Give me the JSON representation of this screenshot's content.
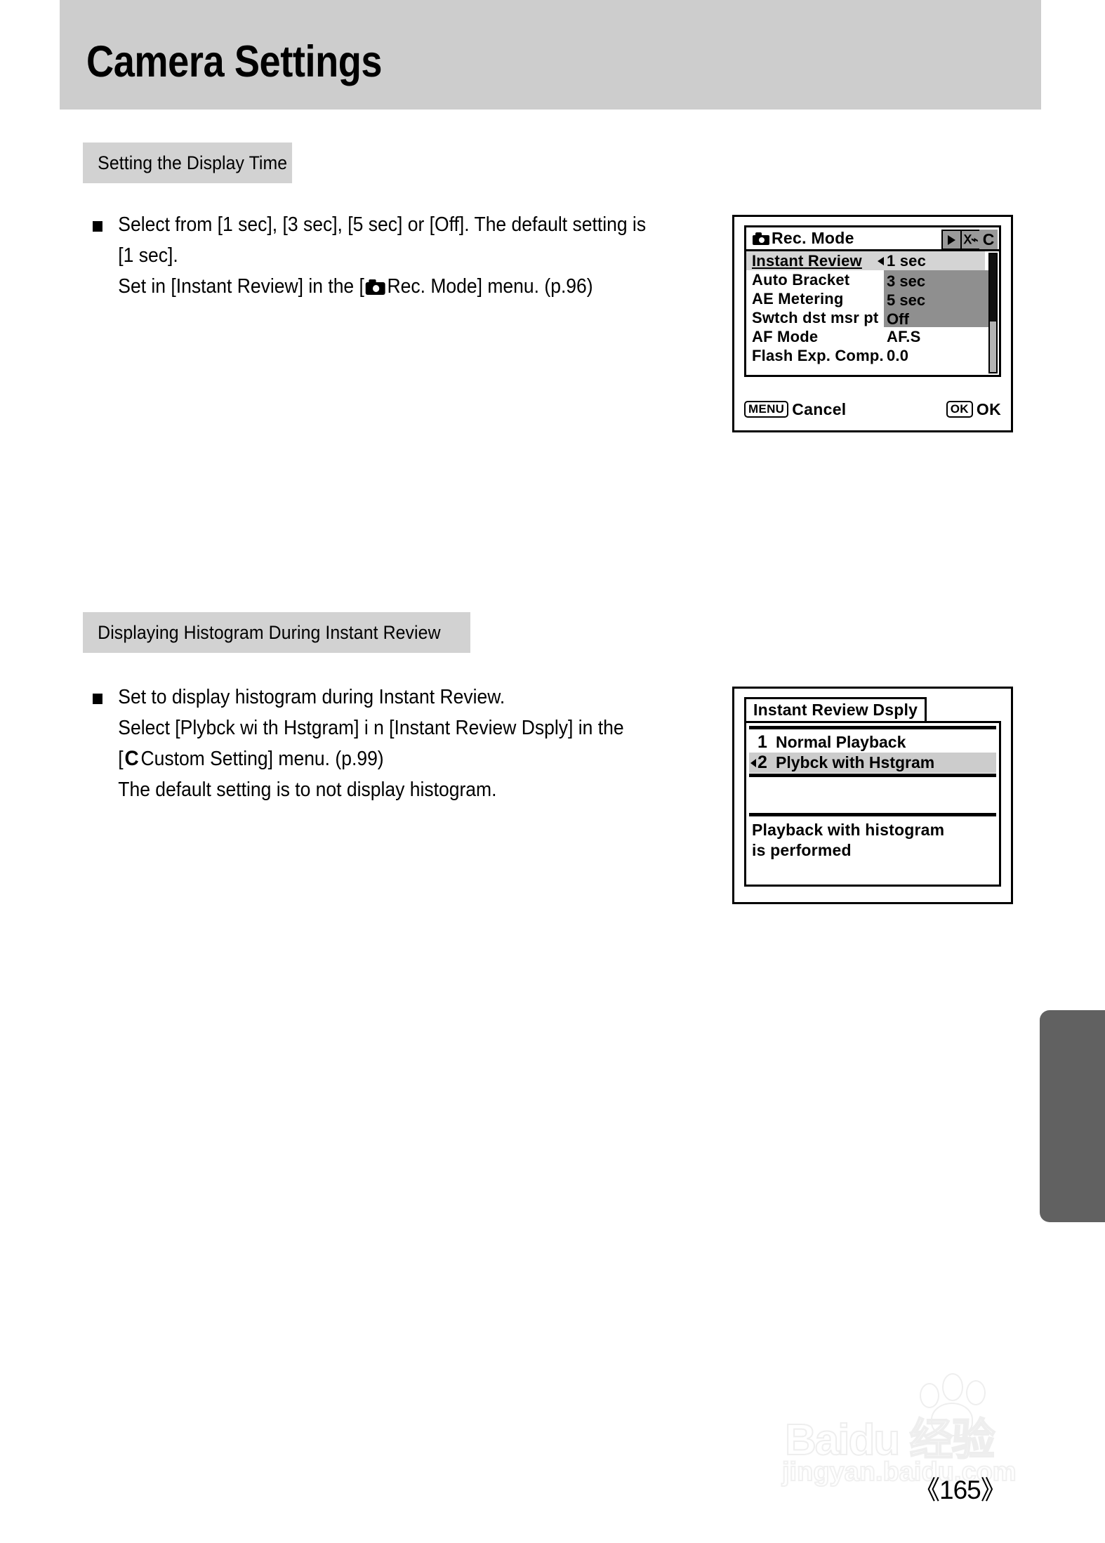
{
  "page": {
    "title": "Camera Settings",
    "number": "《165》"
  },
  "sections": [
    {
      "heading": "Setting the Display Time",
      "lines": [
        {
          "pre": "Select from [1 sec], [3 sec], [5 sec] or [Off]. The default setting is",
          "icon": null,
          "post": ""
        },
        {
          "pre": "[1 sec].",
          "icon": null,
          "post": ""
        },
        {
          "pre": "Set in [Instant Review] in the [",
          "icon": "camera-icon",
          "post": "Rec. Mode] menu. (p.96)"
        }
      ]
    },
    {
      "heading": "Displaying Histogram During Instant Review",
      "lines": [
        {
          "pre": "Set to display histogram during Instant Review.",
          "icon": null,
          "post": ""
        },
        {
          "pre": "Select [Plybck wi th Hstgram] i n [Instant Review Dsply] in the",
          "icon": null,
          "post": ""
        },
        {
          "pre": "[",
          "icon": "c-icon",
          "post": "Custom Setting] menu. (p.99)"
        },
        {
          "pre": "The default setting is to not display histogram.",
          "icon": null,
          "post": ""
        }
      ]
    }
  ],
  "lcd_rec_mode": {
    "title": "Rec. Mode",
    "tabs": [
      "playback-icon",
      "wrench-icon",
      "C"
    ],
    "rows": [
      {
        "label": "Instant Review",
        "value": "1 sec",
        "selected": true
      },
      {
        "label": "Auto Bracket",
        "value": "",
        "selected": false
      },
      {
        "label": "AE Metering",
        "value": "",
        "selected": false
      },
      {
        "label": "Swtch dst msr pt",
        "value": "",
        "selected": false
      },
      {
        "label": "AF Mode",
        "value": "AF.S",
        "selected": false
      },
      {
        "label": "Flash Exp. Comp.",
        "value": "0.0",
        "selected": false
      }
    ],
    "dropdown_options": [
      "3 sec",
      "5 sec",
      "Off"
    ],
    "footer": {
      "left_key": "MENU",
      "left_label": "Cancel",
      "right_key": "OK",
      "right_label": "OK"
    }
  },
  "lcd_instant_review_dsply": {
    "title": "Instant Review Dsply",
    "options": [
      {
        "num": "1",
        "label": "Normal Playback",
        "selected": false
      },
      {
        "num": "2",
        "label": "Plybck with Hstgram",
        "selected": true
      }
    ],
    "description_lines": [
      "Playback with histogram",
      "is performed"
    ]
  },
  "watermark": {
    "logo": "Baidu 经验",
    "url": "jingyan.baidu.com"
  }
}
